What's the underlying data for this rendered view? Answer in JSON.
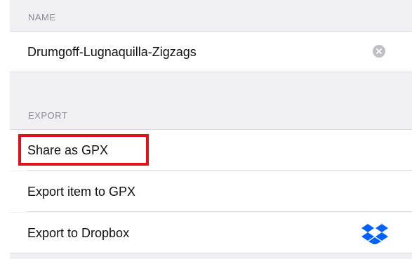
{
  "name_section": {
    "header": "NAME",
    "value": "Drumgoff-Lugnaquilla-Zigzags",
    "clear_icon": "clear-circle-icon"
  },
  "export_section": {
    "header": "EXPORT",
    "items": [
      {
        "label": "Share as GPX",
        "highlighted": true
      },
      {
        "label": "Export item to GPX"
      },
      {
        "label": "Export to Dropbox",
        "icon": "dropbox-icon"
      }
    ]
  },
  "colors": {
    "background": "#efeff4",
    "row": "#ffffff",
    "header_text": "#8a8a8f",
    "highlight": "#e3101b",
    "dropbox": "#0061fe"
  }
}
